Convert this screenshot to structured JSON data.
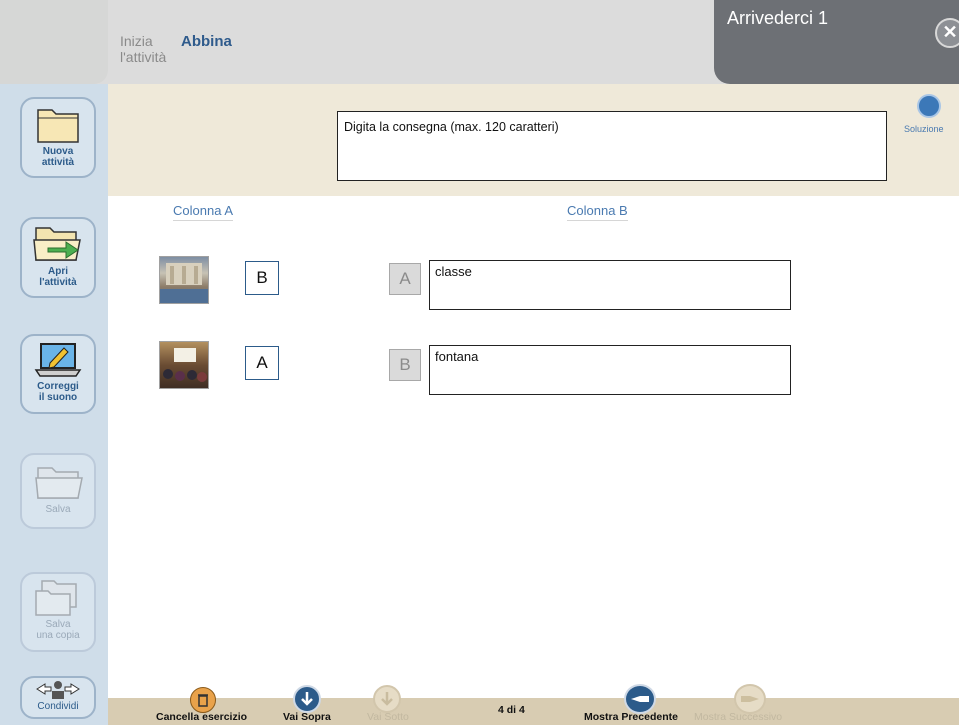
{
  "header": {
    "tab_start_line1": "Inizia",
    "tab_start_line2": "l'attività",
    "tab_active": "Abbina",
    "title": "Arrivederci 1",
    "close_glyph": "✕"
  },
  "sidebar": {
    "items": [
      {
        "label_line1": "Nuova",
        "label_line2": "attività",
        "icon": "folder-icon",
        "enabled": true
      },
      {
        "label_line1": "Apri",
        "label_line2": "l'attività",
        "icon": "open-folder-icon",
        "enabled": true
      },
      {
        "label_line1": "Correggi",
        "label_line2": "il suono",
        "icon": "laptop-edit-icon",
        "enabled": true
      },
      {
        "label_line1": "Salva",
        "label_line2": "",
        "icon": "save-folder-icon",
        "enabled": false
      },
      {
        "label_line1": "Salva",
        "label_line2": "una copia",
        "icon": "save-copy-icon",
        "enabled": false
      },
      {
        "label_line1": "Condividi",
        "label_line2": "",
        "icon": "share-icon",
        "enabled": true
      }
    ]
  },
  "instruction": {
    "text": "Digita  la consegna (max. 120 caratteri)",
    "soluzione_label": "Soluzione"
  },
  "columns": {
    "a_header": "Colonna A",
    "b_header": "Colonna B"
  },
  "rows": [
    {
      "a_image": "fountain-photo",
      "a_letter": "B",
      "b_letter": "A",
      "b_word": "classe"
    },
    {
      "a_image": "classroom-photo",
      "a_letter": "A",
      "b_letter": "B",
      "b_word": "fontana"
    }
  ],
  "footer": {
    "cancel": "Cancella esercizio",
    "go_up": "Vai Sopra",
    "go_down": "Vai Sotto",
    "page_indicator": "4 di 4",
    "show_prev": "Mostra Precedente",
    "show_next": "Mostra Successivo"
  },
  "colors": {
    "accent_blue": "#2c5b8a",
    "sidebar_bg": "#cfdde9",
    "instruction_band": "#efe9d9",
    "footer_bg": "#d8ccb2",
    "title_bg": "#6d7075"
  }
}
